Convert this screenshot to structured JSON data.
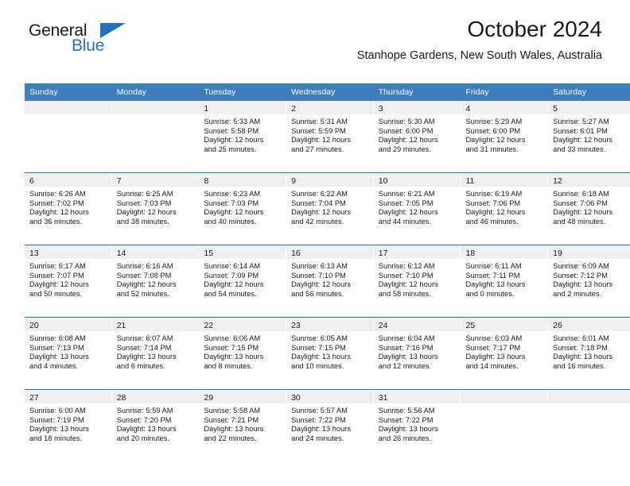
{
  "brand": {
    "word_one": "General",
    "word_two": "Blue",
    "triangle_icon": "triangle-icon",
    "accent_color": "#1f72bd"
  },
  "header": {
    "title": "October 2024",
    "subtitle": "Stanhope Gardens, New South Wales, Australia"
  },
  "calendar": {
    "header_bg": "#3b7dbd",
    "daynum_band_bg": "#efefef",
    "row_border_color": "#1f72bd",
    "weekday_headers": [
      "Sunday",
      "Monday",
      "Tuesday",
      "Wednesday",
      "Thursday",
      "Friday",
      "Saturday"
    ],
    "weeks": [
      [
        {
          "day": "",
          "empty": true
        },
        {
          "day": "",
          "empty": true
        },
        {
          "day": "1",
          "sunrise": "Sunrise: 5:33 AM",
          "sunset": "Sunset: 5:58 PM",
          "daylight_line1": "Daylight: 12 hours",
          "daylight_line2": "and 25 minutes."
        },
        {
          "day": "2",
          "sunrise": "Sunrise: 5:31 AM",
          "sunset": "Sunset: 5:59 PM",
          "daylight_line1": "Daylight: 12 hours",
          "daylight_line2": "and 27 minutes."
        },
        {
          "day": "3",
          "sunrise": "Sunrise: 5:30 AM",
          "sunset": "Sunset: 6:00 PM",
          "daylight_line1": "Daylight: 12 hours",
          "daylight_line2": "and 29 minutes."
        },
        {
          "day": "4",
          "sunrise": "Sunrise: 5:29 AM",
          "sunset": "Sunset: 6:00 PM",
          "daylight_line1": "Daylight: 12 hours",
          "daylight_line2": "and 31 minutes."
        },
        {
          "day": "5",
          "sunrise": "Sunrise: 5:27 AM",
          "sunset": "Sunset: 6:01 PM",
          "daylight_line1": "Daylight: 12 hours",
          "daylight_line2": "and 33 minutes."
        }
      ],
      [
        {
          "day": "6",
          "sunrise": "Sunrise: 6:26 AM",
          "sunset": "Sunset: 7:02 PM",
          "daylight_line1": "Daylight: 12 hours",
          "daylight_line2": "and 36 minutes."
        },
        {
          "day": "7",
          "sunrise": "Sunrise: 6:25 AM",
          "sunset": "Sunset: 7:03 PM",
          "daylight_line1": "Daylight: 12 hours",
          "daylight_line2": "and 38 minutes."
        },
        {
          "day": "8",
          "sunrise": "Sunrise: 6:23 AM",
          "sunset": "Sunset: 7:03 PM",
          "daylight_line1": "Daylight: 12 hours",
          "daylight_line2": "and 40 minutes."
        },
        {
          "day": "9",
          "sunrise": "Sunrise: 6:22 AM",
          "sunset": "Sunset: 7:04 PM",
          "daylight_line1": "Daylight: 12 hours",
          "daylight_line2": "and 42 minutes."
        },
        {
          "day": "10",
          "sunrise": "Sunrise: 6:21 AM",
          "sunset": "Sunset: 7:05 PM",
          "daylight_line1": "Daylight: 12 hours",
          "daylight_line2": "and 44 minutes."
        },
        {
          "day": "11",
          "sunrise": "Sunrise: 6:19 AM",
          "sunset": "Sunset: 7:06 PM",
          "daylight_line1": "Daylight: 12 hours",
          "daylight_line2": "and 46 minutes."
        },
        {
          "day": "12",
          "sunrise": "Sunrise: 6:18 AM",
          "sunset": "Sunset: 7:06 PM",
          "daylight_line1": "Daylight: 12 hours",
          "daylight_line2": "and 48 minutes."
        }
      ],
      [
        {
          "day": "13",
          "sunrise": "Sunrise: 6:17 AM",
          "sunset": "Sunset: 7:07 PM",
          "daylight_line1": "Daylight: 12 hours",
          "daylight_line2": "and 50 minutes."
        },
        {
          "day": "14",
          "sunrise": "Sunrise: 6:16 AM",
          "sunset": "Sunset: 7:08 PM",
          "daylight_line1": "Daylight: 12 hours",
          "daylight_line2": "and 52 minutes."
        },
        {
          "day": "15",
          "sunrise": "Sunrise: 6:14 AM",
          "sunset": "Sunset: 7:09 PM",
          "daylight_line1": "Daylight: 12 hours",
          "daylight_line2": "and 54 minutes."
        },
        {
          "day": "16",
          "sunrise": "Sunrise: 6:13 AM",
          "sunset": "Sunset: 7:10 PM",
          "daylight_line1": "Daylight: 12 hours",
          "daylight_line2": "and 56 minutes."
        },
        {
          "day": "17",
          "sunrise": "Sunrise: 6:12 AM",
          "sunset": "Sunset: 7:10 PM",
          "daylight_line1": "Daylight: 12 hours",
          "daylight_line2": "and 58 minutes."
        },
        {
          "day": "18",
          "sunrise": "Sunrise: 6:11 AM",
          "sunset": "Sunset: 7:11 PM",
          "daylight_line1": "Daylight: 13 hours",
          "daylight_line2": "and 0 minutes."
        },
        {
          "day": "19",
          "sunrise": "Sunrise: 6:09 AM",
          "sunset": "Sunset: 7:12 PM",
          "daylight_line1": "Daylight: 13 hours",
          "daylight_line2": "and 2 minutes."
        }
      ],
      [
        {
          "day": "20",
          "sunrise": "Sunrise: 6:08 AM",
          "sunset": "Sunset: 7:13 PM",
          "daylight_line1": "Daylight: 13 hours",
          "daylight_line2": "and 4 minutes."
        },
        {
          "day": "21",
          "sunrise": "Sunrise: 6:07 AM",
          "sunset": "Sunset: 7:14 PM",
          "daylight_line1": "Daylight: 13 hours",
          "daylight_line2": "and 6 minutes."
        },
        {
          "day": "22",
          "sunrise": "Sunrise: 6:06 AM",
          "sunset": "Sunset: 7:15 PM",
          "daylight_line1": "Daylight: 13 hours",
          "daylight_line2": "and 8 minutes."
        },
        {
          "day": "23",
          "sunrise": "Sunrise: 6:05 AM",
          "sunset": "Sunset: 7:15 PM",
          "daylight_line1": "Daylight: 13 hours",
          "daylight_line2": "and 10 minutes."
        },
        {
          "day": "24",
          "sunrise": "Sunrise: 6:04 AM",
          "sunset": "Sunset: 7:16 PM",
          "daylight_line1": "Daylight: 13 hours",
          "daylight_line2": "and 12 minutes."
        },
        {
          "day": "25",
          "sunrise": "Sunrise: 6:03 AM",
          "sunset": "Sunset: 7:17 PM",
          "daylight_line1": "Daylight: 13 hours",
          "daylight_line2": "and 14 minutes."
        },
        {
          "day": "26",
          "sunrise": "Sunrise: 6:01 AM",
          "sunset": "Sunset: 7:18 PM",
          "daylight_line1": "Daylight: 13 hours",
          "daylight_line2": "and 16 minutes."
        }
      ],
      [
        {
          "day": "27",
          "sunrise": "Sunrise: 6:00 AM",
          "sunset": "Sunset: 7:19 PM",
          "daylight_line1": "Daylight: 13 hours",
          "daylight_line2": "and 18 minutes."
        },
        {
          "day": "28",
          "sunrise": "Sunrise: 5:59 AM",
          "sunset": "Sunset: 7:20 PM",
          "daylight_line1": "Daylight: 13 hours",
          "daylight_line2": "and 20 minutes."
        },
        {
          "day": "29",
          "sunrise": "Sunrise: 5:58 AM",
          "sunset": "Sunset: 7:21 PM",
          "daylight_line1": "Daylight: 13 hours",
          "daylight_line2": "and 22 minutes."
        },
        {
          "day": "30",
          "sunrise": "Sunrise: 5:57 AM",
          "sunset": "Sunset: 7:22 PM",
          "daylight_line1": "Daylight: 13 hours",
          "daylight_line2": "and 24 minutes."
        },
        {
          "day": "31",
          "sunrise": "Sunrise: 5:56 AM",
          "sunset": "Sunset: 7:22 PM",
          "daylight_line1": "Daylight: 13 hours",
          "daylight_line2": "and 26 minutes."
        },
        {
          "day": "",
          "empty": true
        },
        {
          "day": "",
          "empty": true
        }
      ]
    ]
  }
}
